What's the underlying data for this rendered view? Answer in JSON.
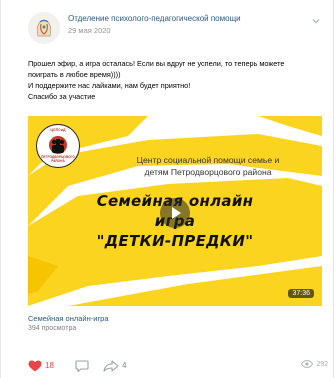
{
  "post": {
    "group_name": "Отделение психолого-педагогической помощи",
    "date": "29 мая 2020",
    "text_lines": [
      "Прошел эфир, а игра осталась! Если вы вдруг не успели, то теперь можете",
      "поиграть в любое время))))",
      "И поддержите нас лайками, нам будет приятно!",
      "Спасибо за участие"
    ]
  },
  "video": {
    "logo_top": "ЦСПСиД",
    "logo_bottom": "ПЕТРОДВОРЦОВОГО РАЙОНА",
    "subtitle_line1": "Центр социальной помощи семье и",
    "subtitle_line2": "детям Петродворцового района",
    "title_line1": "Семейная онлайн",
    "title_line2": "игра",
    "title_line3": "\"ДЕТКИ-ПРЕДКИ\"",
    "duration": "37:36",
    "caption_title": "Семейная онлайн-игра",
    "caption_views": "394 просмотра"
  },
  "actions": {
    "likes": "18",
    "shares": "4",
    "views": "292"
  },
  "colors": {
    "link": "#2a5885",
    "like": "#e64646",
    "video_yellow": "#fbd41f",
    "muted": "#828282"
  }
}
